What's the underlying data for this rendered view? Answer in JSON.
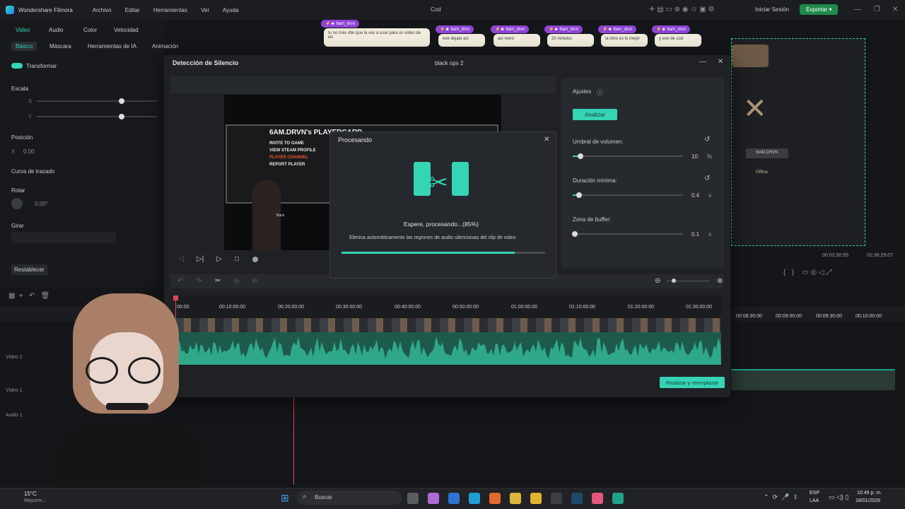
{
  "app": {
    "name": "Wondershare Filmora",
    "project": "Cod",
    "signin": "Iniciar Sesión",
    "export": "Exportar"
  },
  "menu": [
    "Archivo",
    "Editar",
    "Herramientas",
    "Ver",
    "Ayuda"
  ],
  "left_panel": {
    "tabs": [
      "Video",
      "Audio",
      "Color",
      "Velocidad"
    ],
    "subtabs": [
      "Básico",
      "Máscara",
      "Herramientas de IA",
      "Animación"
    ],
    "transform": "Transformar",
    "scale": "Escala",
    "x": "X",
    "y": "Y",
    "position": "Posición",
    "pos_x": "X",
    "pos_x_val": "0.00",
    "curve": "Curva de trazado",
    "rotate": "Rotar",
    "rotate_val": "0.00°",
    "flip": "Girar",
    "reset": "Restablecer"
  },
  "chat": [
    {
      "user": "6am_drvn",
      "text": "tu no mas dile que la vas a usar para un video de wz"
    },
    {
      "user": "6am_drvn",
      "text": "ese dejalo asi"
    },
    {
      "user": "6am_drvn",
      "text": "asi mero"
    },
    {
      "user": "6am_drvn",
      "text": "20 minutos"
    },
    {
      "user": "6am_drvn",
      "text": "la intro es lo mejor"
    },
    {
      "user": "6am_drvn",
      "text": "y ese de cod"
    }
  ],
  "dialog": {
    "title": "Detección de Silencio",
    "file": "black ops 2",
    "settings_title": "Ajustes",
    "analyze": "Analizar",
    "volume_label": "Umbral de volumen:",
    "volume_value": "10",
    "volume_unit": "%",
    "volume_level": 0.07,
    "duration_label": "Duración mínima:",
    "duration_value": "0.4",
    "duration_unit": "s",
    "duration_level": 0.06,
    "buffer_label": "Zona de buffer:",
    "buffer_value": "0.1",
    "buffer_unit": "s",
    "buffer_level": 0.02,
    "replace": "Finalizar y reemplazar",
    "ruler": [
      "00:00",
      "00:10:00:00",
      "00:20:00:00",
      "00:30:00:00",
      "00:40:00:00",
      "00:50:00:00",
      "01:00:00:00",
      "01:10:00:00",
      "01:20:00:00",
      "01:30:00:00"
    ],
    "video_overlay": {
      "title": "6AM.DRVN's PLAYERCARD",
      "items": [
        "INVITE TO GAME",
        "VIEW STEAM PROFILE",
        "PLAYER CHANNEL",
        "REPORT PLAYER"
      ],
      "back": "Back"
    }
  },
  "processing": {
    "title": "Procesando",
    "status": "Espere, procesando...(85%)",
    "desc": "Elimina automáticamente las regiones de audio silenciosas del clip de video",
    "progress": 0.85
  },
  "right_preview": {
    "name": "6AM.DRVN",
    "sub": "Offline",
    "time_current": "00:02:50:55",
    "time_total": "01:36:29:07"
  },
  "timeline": {
    "tracks": [
      "Video 2",
      "Video 1",
      "Audio 1"
    ],
    "ruler": [
      "00:08:30:00",
      "00:09:00:00",
      "00:09:30:00",
      "00:10:00:00"
    ],
    "start": "00:00"
  },
  "taskbar": {
    "temp": "15°C",
    "weather": "Mayorm...",
    "search": "Buscar",
    "lang": "ESP",
    "lang2": "LAA",
    "time": "10:45 p. m.",
    "date": "18/01/2026"
  }
}
